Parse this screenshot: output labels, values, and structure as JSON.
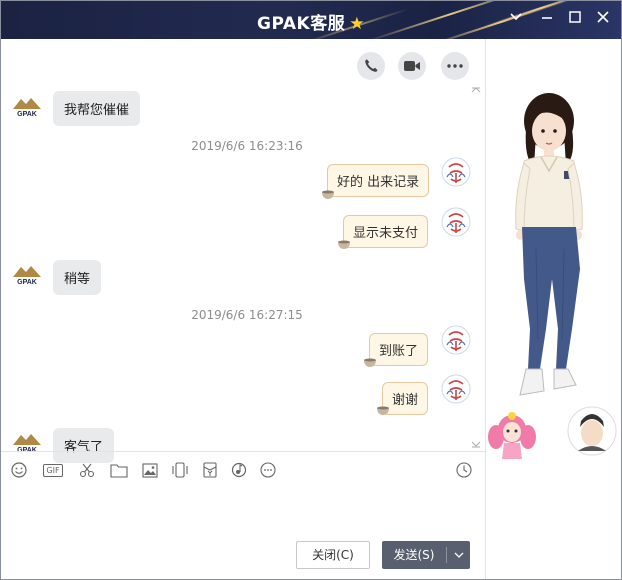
{
  "window": {
    "title": "GPAK客服",
    "title_icon": "star-icon",
    "controls": [
      "chevron-down-icon",
      "maximize-icon",
      "close-icon"
    ]
  },
  "header_actions": [
    "phone-icon",
    "video-icon",
    "more-icon"
  ],
  "messages": [
    {
      "side": "left",
      "text": "我帮您催催",
      "avatar": "GPAK"
    },
    {
      "type": "timestamp",
      "text": "2019/6/6 16:23:16"
    },
    {
      "side": "right",
      "text": "好的 出来记录"
    },
    {
      "side": "right",
      "text": "显示未支付"
    },
    {
      "side": "left",
      "text": "稍等",
      "avatar": "GPAK"
    },
    {
      "type": "timestamp",
      "text": "2019/6/6 16:27:15"
    },
    {
      "side": "right",
      "text": "到账了"
    },
    {
      "side": "right",
      "text": "谢谢"
    },
    {
      "side": "left",
      "text": "客气了",
      "avatar": "GPAK"
    }
  ],
  "input_toolbar": [
    "emoji-icon",
    "gif-icon",
    "scissors-icon",
    "folder-icon",
    "image-icon",
    "shake-icon",
    "red-packet-icon",
    "music-icon",
    "more-icon",
    "history-icon"
  ],
  "input_toolbar_gif_label": "GIF",
  "buttons": {
    "close_label": "关闭(C)",
    "send_label": "发送(S)"
  },
  "colors": {
    "title_bg": "#1d2446",
    "bubble_left": "#e9eaec",
    "bubble_right": "#fff7e6",
    "send_button": "#58606f"
  }
}
